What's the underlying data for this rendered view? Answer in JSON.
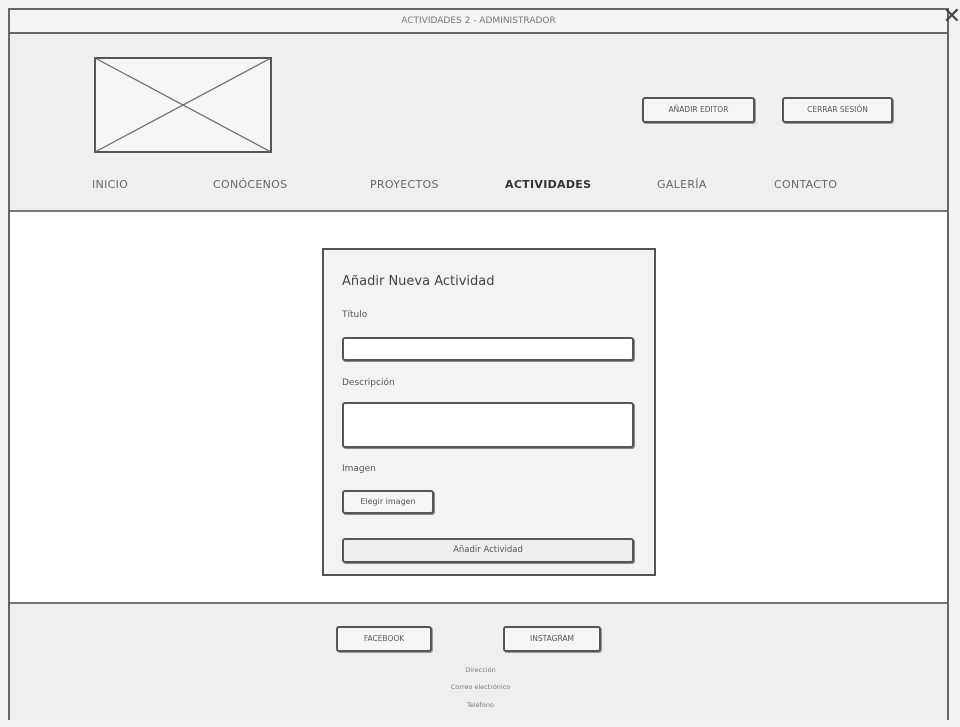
{
  "window": {
    "title": "ACTIVIDADES 2 - ADMINISTRADOR",
    "close_glyph": "✕"
  },
  "header": {
    "add_editor_label": "AÑADIR EDITOR",
    "logout_label": "CERRAR SESIÓN"
  },
  "nav": {
    "items": [
      "INICIO",
      "CONÓCENOS",
      "PROYECTOS",
      "ACTIVIDADES",
      "GALERÍA",
      "CONTACTO"
    ],
    "active": "ACTIVIDADES"
  },
  "form": {
    "title": "Añadir Nueva Actividad",
    "title_label": "Título",
    "title_value": "",
    "description_label": "Descripción",
    "description_value": "",
    "image_label": "Imagen",
    "choose_image_label": "Elegir imagen",
    "submit_label": "Añadir Actividad"
  },
  "footer": {
    "facebook_label": "FACEBOOK",
    "instagram_label": "INSTAGRAM",
    "lines": [
      "Dirección",
      "Correo electrónico",
      "Teléfono"
    ]
  },
  "icons": {
    "logo": "image-placeholder-icon",
    "close": "close-icon"
  }
}
